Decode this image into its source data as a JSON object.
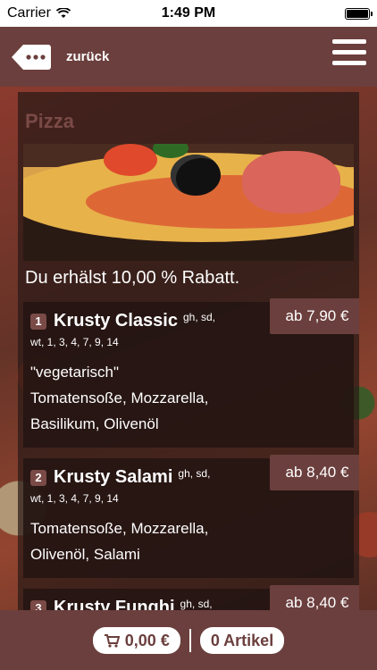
{
  "status": {
    "carrier": "Carrier",
    "time": "1:49 PM"
  },
  "nav": {
    "back_label": "zurück"
  },
  "section": {
    "title": "Pizza",
    "discount": "Du erhälst 10,00 % Rabatt."
  },
  "items": [
    {
      "number": "1",
      "name": "Krusty Classic",
      "allergens": "gh, sd,",
      "codes": "wt, 1, 3, 4, 7, 9, 14",
      "description_lines": [
        "\"vegetarisch\"",
        "Tomatensoße, Mozzarella,",
        "Basilikum, Olivenöl"
      ],
      "price": "ab 7,90 €"
    },
    {
      "number": "2",
      "name": "Krusty Salami",
      "allergens": "gh, sd,",
      "codes": "wt, 1, 3, 4, 7, 9, 14",
      "description_lines": [
        "Tomatensoße, Mozzarella,",
        "Olivenöl, Salami"
      ],
      "price": "ab 8,40 €"
    },
    {
      "number": "3",
      "name": "Krusty Funghi",
      "allergens": "gh, sd,",
      "codes": "",
      "description_lines": [],
      "price": "ab 8,40 €"
    }
  ],
  "cart": {
    "total": "0,00 €",
    "count": "0 Artikel"
  },
  "colors": {
    "brand": "#6b3f3d",
    "title_muted": "#7a4a47"
  }
}
